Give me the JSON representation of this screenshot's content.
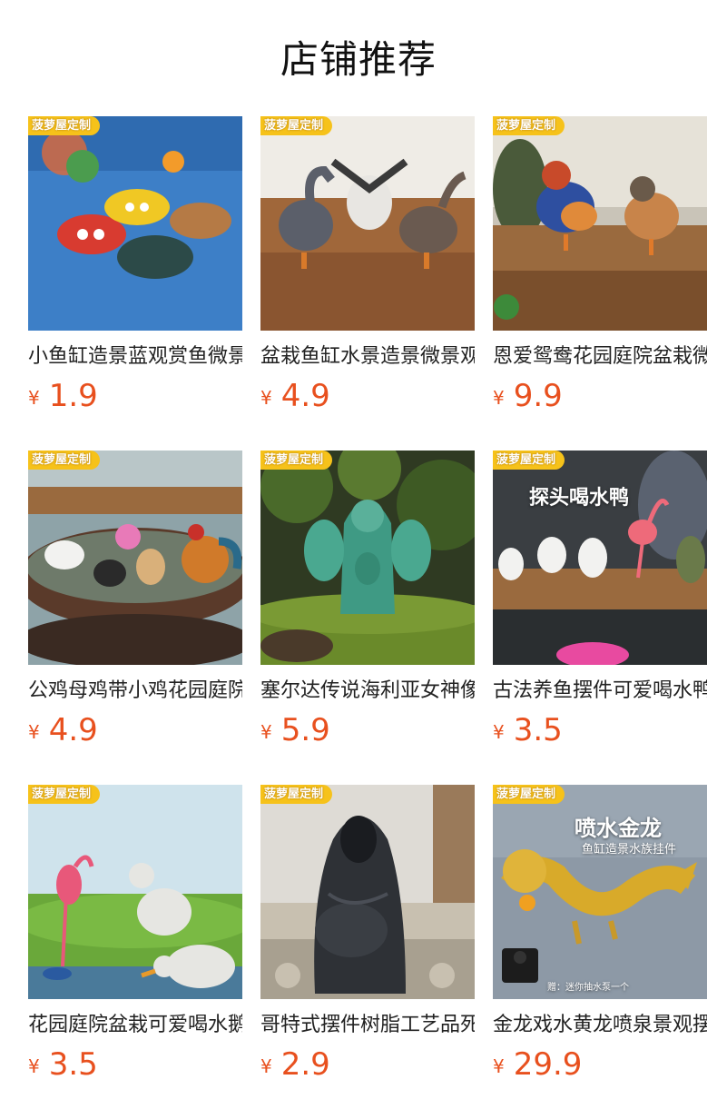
{
  "page": {
    "title": "店铺推荐"
  },
  "badge_text": "菠萝屋定制",
  "currency_symbol": "¥",
  "colors": {
    "price": "#e8501e",
    "badge": "#f6c21a"
  },
  "products": [
    {
      "name": "小鱼缸造景蓝观赏鱼微景观摆件",
      "price": "1.9",
      "image": "toy-submarines-on-blue-sand"
    },
    {
      "name": "盆栽鱼缸水景造景微景观大鹅摆件",
      "price": "4.9",
      "image": "geese-on-wooden-branch"
    },
    {
      "name": "恩爱鸳鸯花园庭院盆栽微景观摆件",
      "price": "9.9",
      "image": "mandarin-ducks-on-wood"
    },
    {
      "name": "公鸡母鸡带小鸡花园庭院摆件",
      "price": "4.9",
      "image": "chickens-on-bowl-rim"
    },
    {
      "name": "塞尔达传说海利亚女神像摆件",
      "price": "5.9",
      "image": "green-goddess-statue-on-moss"
    },
    {
      "name": "古法养鱼摆件可爱喝水鸭",
      "price": "3.5",
      "image": "drinking-ducks-and-flamingo",
      "overlay": "探头喝水鸭"
    },
    {
      "name": "花园庭院盆栽可爱喝水鹅摆件",
      "price": "3.5",
      "image": "flamingo-and-geese-on-grass"
    },
    {
      "name": "哥特式摆件树脂工艺品死神",
      "price": "2.9",
      "image": "hooded-reaper-figure"
    },
    {
      "name": "金龙戏水黄龙喷泉景观摆件",
      "price": "29.9",
      "image": "golden-dragon-fountain",
      "overlay": "喷水金龙",
      "overlay_sub": "鱼缸造景水族挂件",
      "overlay_note": "赠：迷你抽水泵一个"
    }
  ]
}
